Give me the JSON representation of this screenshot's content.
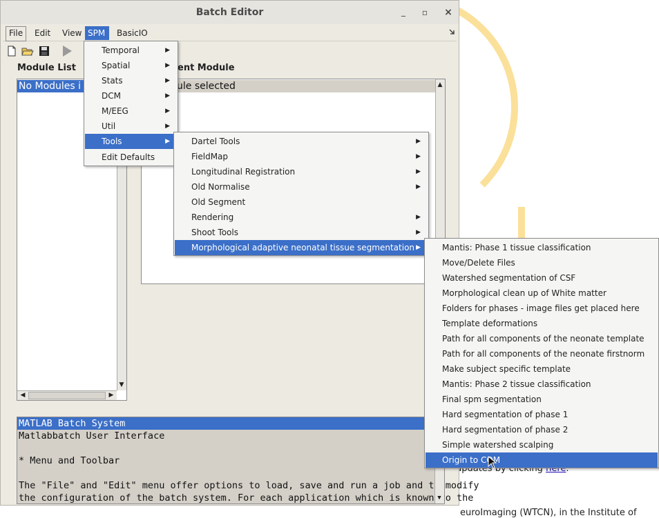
{
  "background_page": {
    "link_line_prefix": "updates by clicking ",
    "link_text": "here",
    "link_line_suffix": ".",
    "bottom_text": "euroImaging (WTCN), in the Institute of"
  },
  "window": {
    "title": "Batch Editor",
    "minimize_label": "_",
    "maximize_label": "▫",
    "close_label": "×"
  },
  "menubar": {
    "file": "File",
    "edit": "Edit",
    "view": "View",
    "spm": "SPM",
    "basicio": "BasicIO"
  },
  "panels": {
    "module_list_label": "Module List",
    "current_module_label": "ent Module",
    "module_list_selected": "No Modules i",
    "current_module_text": "ule selected"
  },
  "info": {
    "lines": [
      "MATLAB Batch System",
      "Matlabbatch User Interface",
      "",
      "* Menu and Toolbar",
      "",
      "The \"File\" and \"Edit\" menu offer options to load, save and run a job and to modify",
      "the configuration of the batch system. For each application which is known to the"
    ]
  },
  "spm_menu": {
    "items": [
      "Temporal",
      "Spatial",
      "Stats",
      "DCM",
      "M/EEG",
      "Util",
      "Tools",
      "Edit Defaults"
    ]
  },
  "tools_menu": {
    "items": [
      "Dartel Tools",
      "FieldMap",
      "Longitudinal Registration",
      "Old Normalise",
      "Old Segment",
      "Rendering",
      "Shoot Tools",
      "Morphological adaptive neonatal tissue segmentation"
    ]
  },
  "mantis_menu": {
    "items": [
      "Mantis: Phase 1 tissue classification",
      "Move/Delete Files",
      "Watershed segmentation of CSF",
      "Morphological clean up of White matter",
      "Folders for phases - image files get placed here",
      "Template deformations",
      "Path for all components of the neonate template",
      "Path for all components of the neonate firstnorm",
      "Make subject specific template",
      "Mantis: Phase 2 tissue classification",
      "Final spm segmentation",
      "Hard segmentation of phase 1",
      "Hard segmentation of phase 2",
      "Simple watershed scalping",
      "Origin to COM"
    ]
  },
  "colors": {
    "selection": "#3b6fc8",
    "window_bg": "#edeae2",
    "accent_arc": "#fbe09a"
  }
}
